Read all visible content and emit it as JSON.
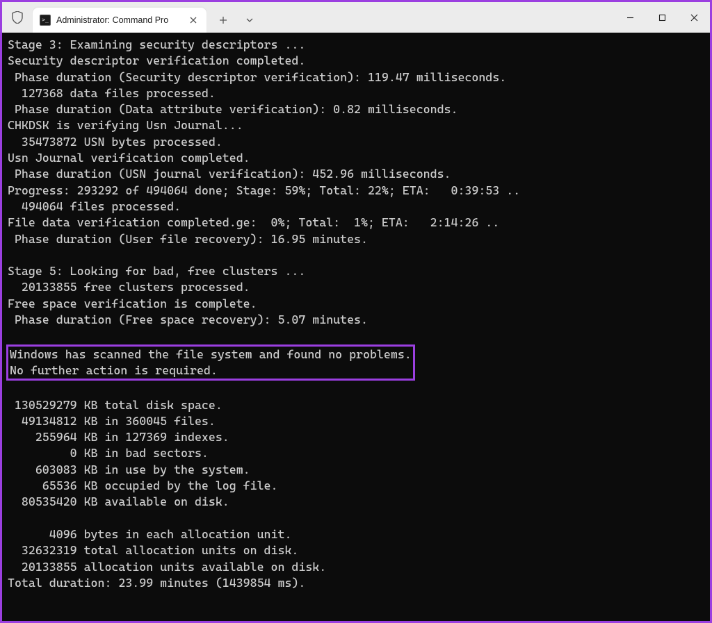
{
  "window": {
    "tab_title": "Administrator: Command Pro"
  },
  "terminal": {
    "line01": "Stage 3: Examining security descriptors ...",
    "line02": "Security descriptor verification completed.",
    "line03": " Phase duration (Security descriptor verification): 119.47 milliseconds.",
    "line04": "  127368 data files processed.",
    "line05": " Phase duration (Data attribute verification): 0.82 milliseconds.",
    "line06": "CHKDSK is verifying Usn Journal...",
    "line07": "  35473872 USN bytes processed.",
    "line08": "Usn Journal verification completed.",
    "line09": " Phase duration (USN journal verification): 452.96 milliseconds.",
    "line10": "Progress: 293292 of 494064 done; Stage: 59%; Total: 22%; ETA:   0:39:53 ..",
    "line11": "  494064 files processed.",
    "line12": "File data verification completed.ge:  0%; Total:  1%; ETA:   2:14:26 ..",
    "line13": " Phase duration (User file recovery): 16.95 minutes.",
    "line14": "",
    "line15": "Stage 5: Looking for bad, free clusters ...",
    "line16": "  20133855 free clusters processed.",
    "line17": "Free space verification is complete.",
    "line18": " Phase duration (Free space recovery): 5.07 minutes.",
    "line19": "",
    "box_line1": "Windows has scanned the file system and found no problems.",
    "box_line2": "No further action is required.",
    "line22": "",
    "line23": " 130529279 KB total disk space.",
    "line24": "  49134812 KB in 360045 files.",
    "line25": "    255964 KB in 127369 indexes.",
    "line26": "         0 KB in bad sectors.",
    "line27": "    603083 KB in use by the system.",
    "line28": "     65536 KB occupied by the log file.",
    "line29": "  80535420 KB available on disk.",
    "line30": "",
    "line31": "      4096 bytes in each allocation unit.",
    "line32": "  32632319 total allocation units on disk.",
    "line33": "  20133855 allocation units available on disk.",
    "line34": "Total duration: 23.99 minutes (1439854 ms)."
  }
}
